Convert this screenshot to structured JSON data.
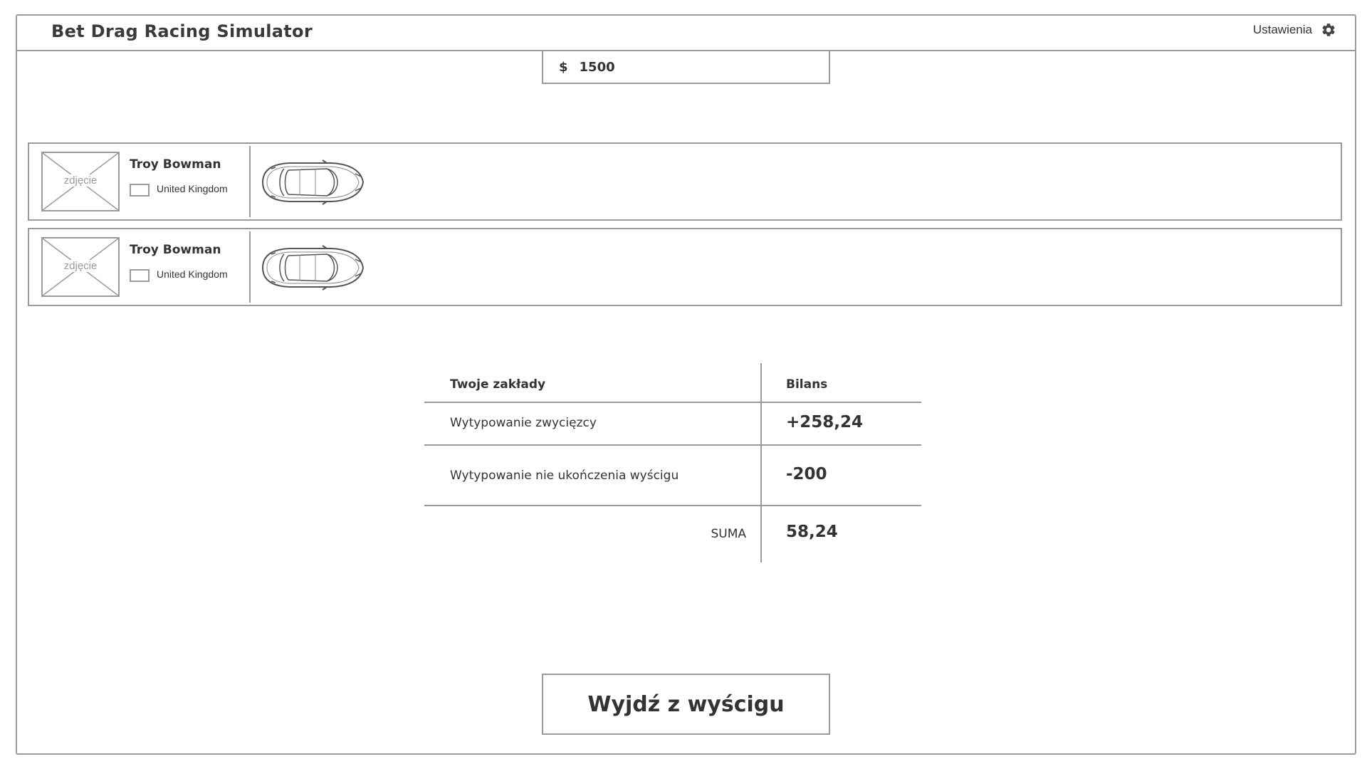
{
  "app": {
    "title": "Bet Drag Racing Simulator"
  },
  "header": {
    "settings_label": "Ustawienia",
    "settings_icon": "gear-icon"
  },
  "balance": {
    "currency_symbol": "$",
    "amount": "1500"
  },
  "racers": [
    {
      "photo_placeholder": "zdjęcie",
      "name": "Troy Bowman",
      "country": "United Kingdom",
      "car_icon": "car-icon"
    },
    {
      "photo_placeholder": "zdjęcie",
      "name": "Troy Bowman",
      "country": "United Kingdom",
      "car_icon": "car-icon"
    }
  ],
  "bets_table": {
    "headers": {
      "bets": "Twoje zakłady",
      "balance": "Bilans"
    },
    "rows": [
      {
        "label": "Wytypowanie zwycięzcy",
        "value": "+258,24",
        "status": "positive"
      },
      {
        "label": "Wytypowanie nie ukończenia wyścigu",
        "value": "-200",
        "status": "negative"
      }
    ],
    "total": {
      "label": "SUMA",
      "value": "58,24",
      "status": "positive"
    }
  },
  "colors": {
    "positive": "#22c53c",
    "negative": "#e00b0b",
    "border": "#9a9a9a",
    "text": "#333333"
  },
  "actions": {
    "exit_label": "Wyjdź z wyścigu"
  }
}
